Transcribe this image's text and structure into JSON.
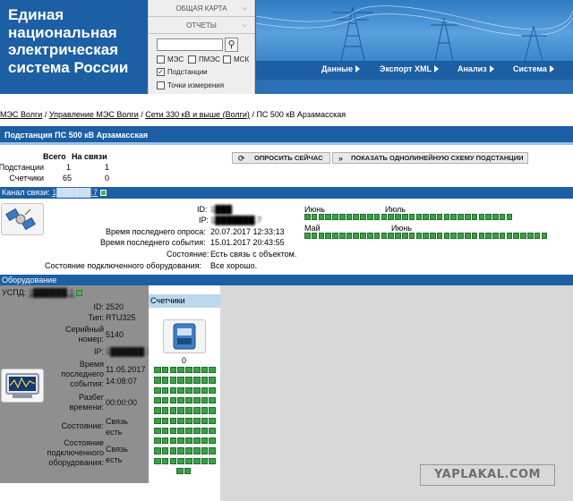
{
  "header": {
    "logo_lines": [
      "Единая",
      "национальная",
      "электрическая",
      "система России"
    ],
    "menu_map": "ОБЩАЯ КАРТА",
    "menu_reports": "ОТЧЕТЫ",
    "search_placeholder": "",
    "filters": [
      {
        "label": "МЭС",
        "checked": false
      },
      {
        "label": "ПМЭС",
        "checked": false
      },
      {
        "label": "МСК",
        "checked": false
      },
      {
        "label": "Подстанции",
        "checked": true
      },
      {
        "label": "Точки измерения",
        "checked": false
      }
    ],
    "nav": [
      "Данные",
      "Экспорт XML",
      "Анализ",
      "Система"
    ]
  },
  "breadcrumb": {
    "items": [
      "МЭС Волги",
      "Управление МЭС Волги",
      "Сети 330 кВ и выше (Волги)"
    ],
    "separator": " / ",
    "current": "ПС 500 кВ Арзамасская"
  },
  "title": "Подстанция ПС 500 кВ Арзамасская",
  "summary": {
    "col_total": "Всего",
    "col_online": "На связи",
    "rows": [
      {
        "label": "Подстанции",
        "total": "1",
        "online": "1"
      },
      {
        "label": "Счетчики",
        "total": "65",
        "online": "0"
      }
    ]
  },
  "actions": {
    "poll_now": "ОПРОСИТЬ СЕЙЧАС",
    "show_scheme": "ПОКАЗАТЬ ОДНОЛИНЕЙНУЮ СХЕМУ ПОДСТАНЦИИ"
  },
  "channel": {
    "label": "Канал связи:",
    "link_text": "1██████.7",
    "id_label": "ID:",
    "id_value": "1███",
    "ip_label": "IP:",
    "ip_value": "1███████.7",
    "last_poll_label": "Время последнего опроса:",
    "last_poll_value": "20.07.2017 12:33:13",
    "last_event_label": "Время последнего события:",
    "last_event_value": "15.01.2017 20:43:55",
    "state_label": "Состояние:",
    "state_value": "Есть связь с объектом.",
    "equip_state_label": "Состояние подключенного оборудования:",
    "equip_state_value": "Все хорошо.",
    "months_row1": [
      "Июнь",
      "Июль"
    ],
    "months_row2": [
      "Май",
      "Июнь"
    ],
    "grid_row1_count": 30,
    "grid_row2_count": 35
  },
  "equipment": {
    "bar_label": "Оборудование",
    "uspd_label": "УСПД:",
    "uspd_link": "1██████.1",
    "fields": [
      {
        "key": "ID:",
        "value": "2520"
      },
      {
        "key": "Тип:",
        "value": "RTU325"
      },
      {
        "key": "Серийный номер:",
        "value": "5140"
      },
      {
        "key": "IP:",
        "value": "1██████.1"
      },
      {
        "key": "Время последнего события:",
        "value": "11.05.2017 14:08:07"
      },
      {
        "key": "Разбег времени:",
        "value": "00:00:00"
      },
      {
        "key": "Состояние:",
        "value": "Связь есть"
      },
      {
        "key": "Состояние подключенного оборудования:",
        "value": "Связь есть"
      }
    ],
    "meters_header": "Счетчики",
    "meters_count": "0",
    "meter_grid_rows": [
      8,
      8,
      8,
      8,
      8,
      8,
      8,
      8,
      8,
      8,
      2
    ]
  },
  "watermark": "YAPLAKAL.COM",
  "colors": {
    "header_blue": "#1d5fa4",
    "status_green": "#3aa14a",
    "panel_gray": "#8f8f8f"
  }
}
